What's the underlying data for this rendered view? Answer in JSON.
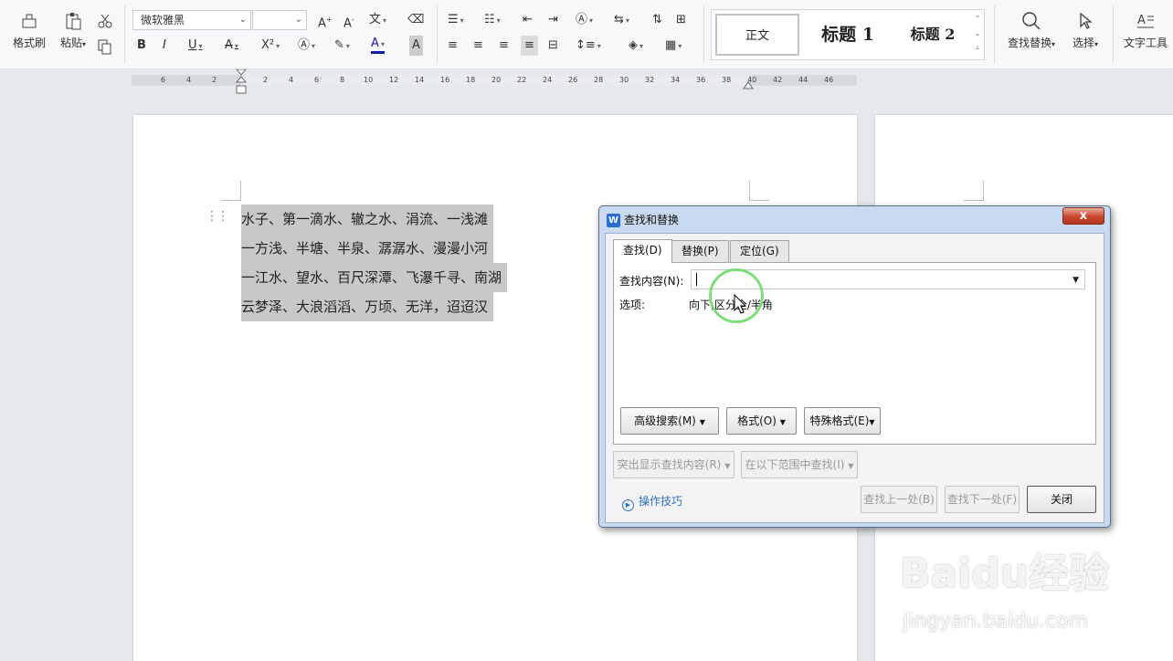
{
  "ribbon": {
    "format_painter": "格式刷",
    "paste": "粘贴",
    "font_name": "微软雅黑",
    "font_size": "",
    "styles": {
      "normal": "正文",
      "heading1": "标题 1",
      "heading2": "标题 2"
    },
    "find_replace": "查找替换",
    "select": "选择",
    "text_tools": "文字工具",
    "accent_color": "#2a6cd4"
  },
  "ruler": {
    "ticks": [
      "6",
      "4",
      "2",
      "2",
      "4",
      "6",
      "8",
      "10",
      "12",
      "14",
      "16",
      "18",
      "20",
      "22",
      "24",
      "26",
      "28",
      "30",
      "32",
      "34",
      "36",
      "38",
      "40",
      "42",
      "44",
      "46"
    ]
  },
  "document": {
    "lines": [
      "水子、第一滴水、辙之水、涓流、一浅滩",
      "一方浅、半塘、半泉、潺潺水、漫漫小河",
      "一江水、望水、百尺深潭、飞瀑千寻、南湖",
      "云梦泽、大浪滔滔、万顷、无洋，迢迢汉"
    ]
  },
  "dialog": {
    "title": "查找和替换",
    "tabs": [
      "查找(D)",
      "替换(P)",
      "定位(G)"
    ],
    "find_label": "查找内容(N):",
    "find_value": "",
    "options_label": "选项:",
    "options_value": "向下,区分全/半角",
    "buttons": {
      "advanced": "高级搜索(M)",
      "format": "格式(O)",
      "special": "特殊格式(E)",
      "highlight": "突出显示查找内容(R)",
      "find_in": "在以下范围中查找(I)",
      "tips": "操作技巧",
      "find_prev": "查找上一处(B)",
      "find_next": "查找下一处(F)",
      "close": "关闭"
    },
    "close_glyph": "x"
  },
  "watermark": {
    "brand": "Baidu经验",
    "url": "jingyan.baidu.com"
  }
}
